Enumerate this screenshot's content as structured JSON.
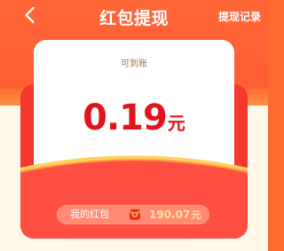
{
  "header": {
    "title": "红包提现",
    "record_label": "提现记录",
    "back_icon": "chevron-left-icon"
  },
  "withdrawal_card": {
    "label": "可到账",
    "amount": "0.19",
    "currency_unit": "元"
  },
  "wallet": {
    "label": "我的红包",
    "icon": "red-envelope-icon",
    "amount": "190.07",
    "currency_unit": "元"
  },
  "colors": {
    "primary_orange": "#ff6a2f",
    "amount_red": "#e2141a",
    "envelope_red": "#f4382e",
    "gold": "#ffd05a",
    "cream": "#fff7e8"
  }
}
